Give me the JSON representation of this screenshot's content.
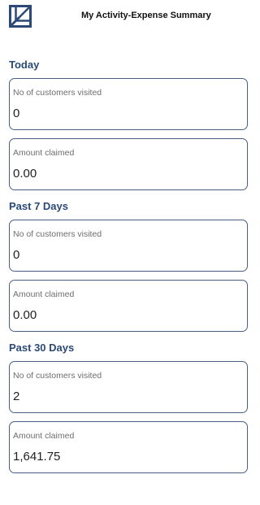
{
  "header": {
    "title": "My Activity-Expense Summary",
    "logo_icon": "square-cube-logo-icon"
  },
  "sections": [
    {
      "title": "Today",
      "customers_label": "No of customers visited",
      "customers_value": "0",
      "amount_label": "Amount claimed",
      "amount_value": "0.00"
    },
    {
      "title": "Past 7 Days",
      "customers_label": "No of customers visited",
      "customers_value": "0",
      "amount_label": "Amount claimed",
      "amount_value": "0.00"
    },
    {
      "title": "Past 30 Days",
      "customers_label": "No of customers visited",
      "customers_value": "2",
      "amount_label": "Amount claimed",
      "amount_value": "1,641.75"
    }
  ],
  "colors": {
    "accent": "#2b4a77",
    "card_border": "#4a5f80",
    "label_text": "#6e6e6e"
  }
}
